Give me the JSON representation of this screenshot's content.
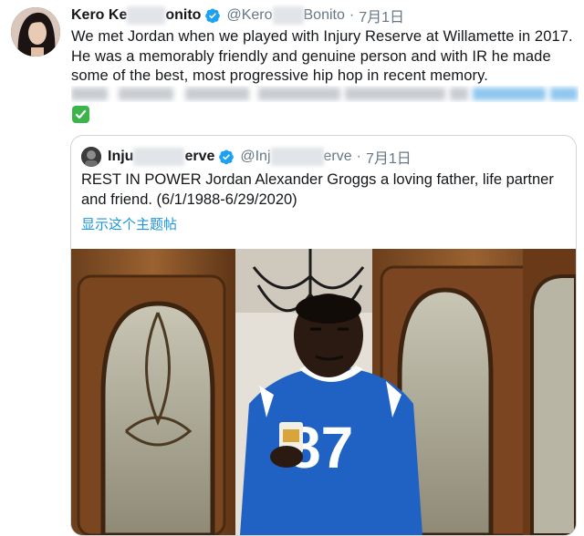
{
  "tweet": {
    "author_name": "Kero Ke",
    "author_name_end": "onito",
    "handle_start": "@Kero",
    "handle_end": "Bonito",
    "separator": "·",
    "date": "7月1日",
    "text": "We met Jordan when we played with Injury Reserve at Willamette in 2017. He was a memorably friendly and genuine person and with IR he made some of the best, most progressive hip hop in recent memory."
  },
  "quoted_tweet": {
    "author_name_start": "Inju",
    "author_name_end": "erve",
    "handle_start": "@Inj",
    "handle_end": "erve",
    "separator": "·",
    "date": "7月1日",
    "text": "REST IN POWER Jordan Alexander Groggs a loving father, life partner and friend. (6/1/1988-6/29/2020)",
    "show_thread_link": "显示这个主题帖",
    "photo_jersey_number": "87"
  },
  "colors": {
    "link": "#1b95e0",
    "secondary_text": "#657786",
    "verified": "#1da1f2",
    "border": "#ccd6dd"
  }
}
